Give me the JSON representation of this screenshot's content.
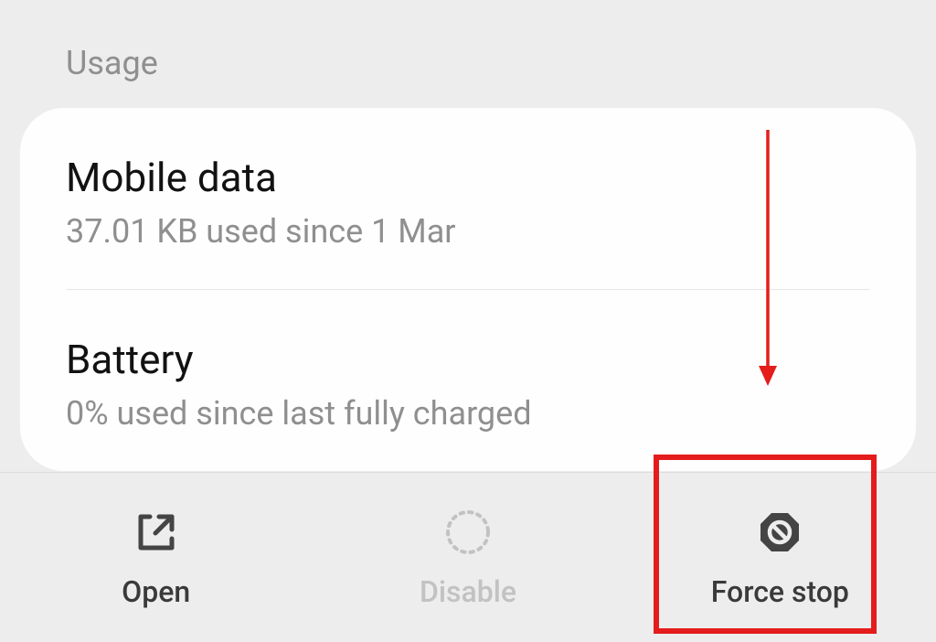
{
  "section": {
    "header": "Usage",
    "items": [
      {
        "title": "Mobile data",
        "subtitle": "37.01 KB used since 1 Mar"
      },
      {
        "title": "Battery",
        "subtitle": "0% used since last fully charged"
      }
    ]
  },
  "actions": {
    "open": "Open",
    "disable": "Disable",
    "force_stop": "Force stop"
  }
}
